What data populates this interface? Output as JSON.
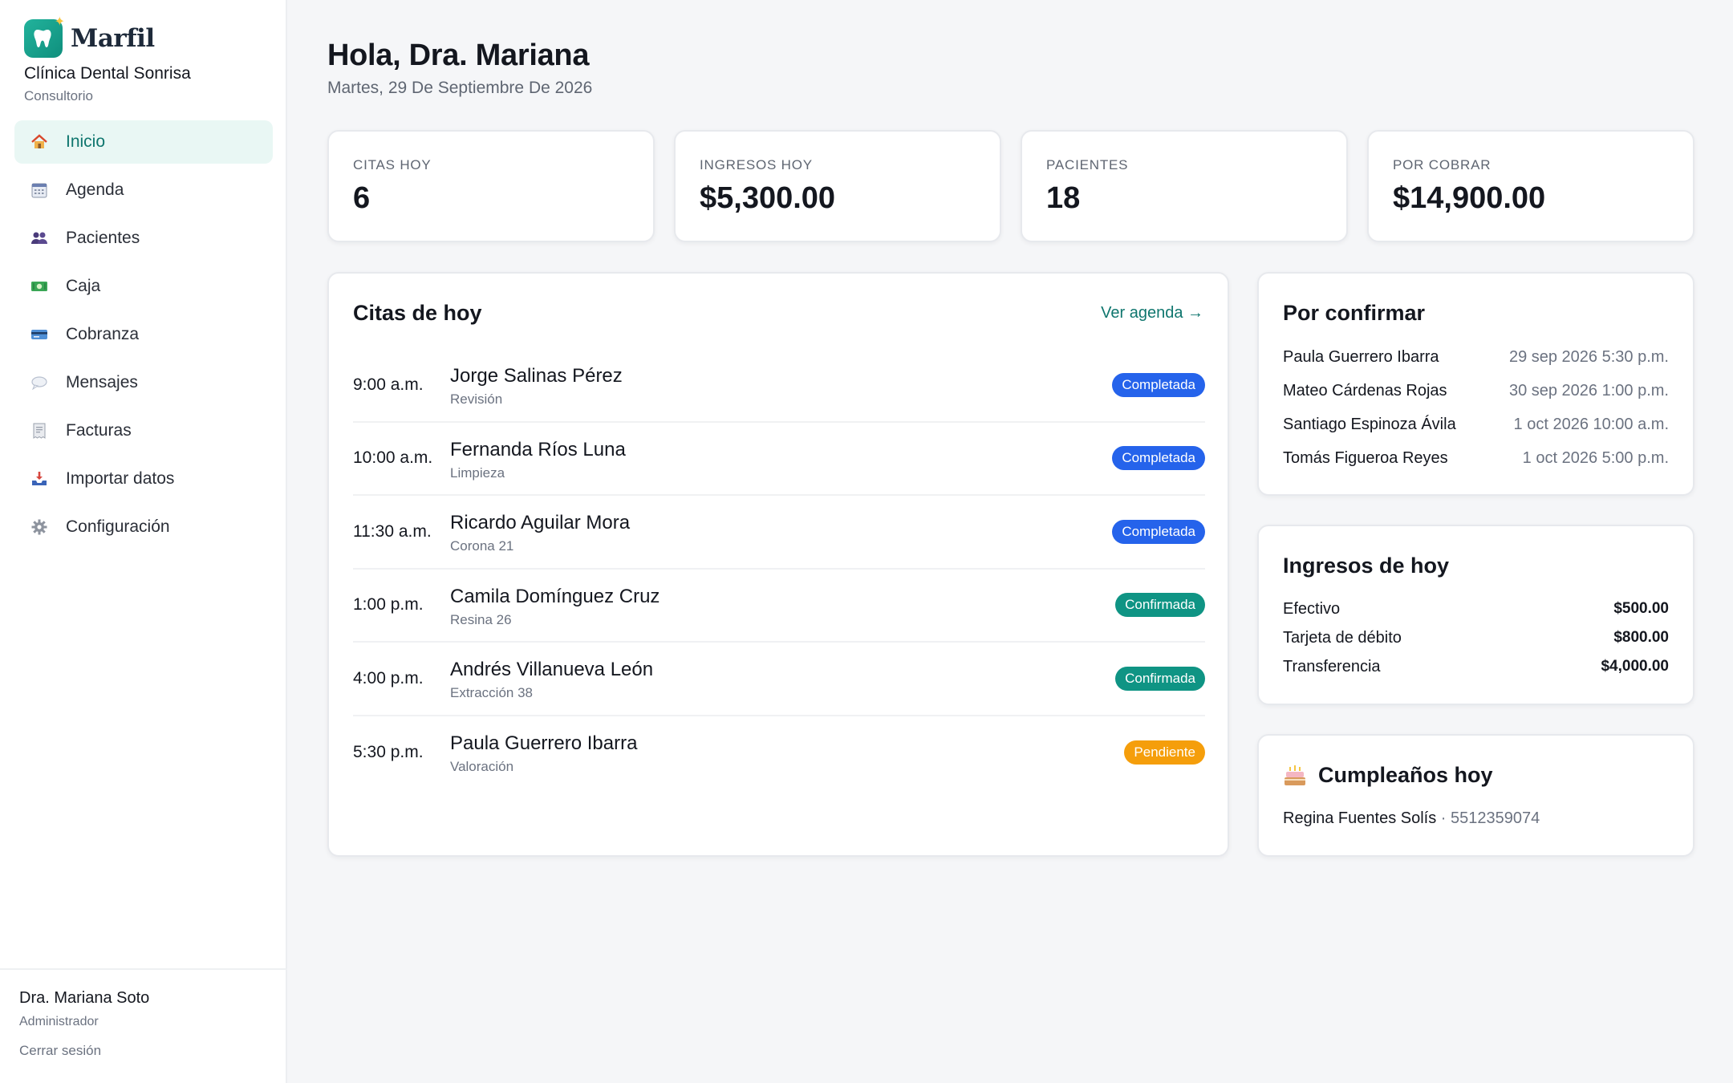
{
  "brand": {
    "name": "Marfil",
    "clinic": "Clínica Dental Sonrisa",
    "clinic_type": "Consultorio",
    "accent": "#0f766e"
  },
  "nav": [
    {
      "label": "Inicio",
      "icon": "house-icon",
      "active": true
    },
    {
      "label": "Agenda",
      "icon": "calendar-icon"
    },
    {
      "label": "Pacientes",
      "icon": "people-icon"
    },
    {
      "label": "Caja",
      "icon": "cash-icon"
    },
    {
      "label": "Cobranza",
      "icon": "credit-card-icon"
    },
    {
      "label": "Mensajes",
      "icon": "speech-bubble-icon"
    },
    {
      "label": "Facturas",
      "icon": "receipt-icon"
    },
    {
      "label": "Importar datos",
      "icon": "inbox-tray-icon"
    },
    {
      "label": "Configuración",
      "icon": "gear-icon"
    }
  ],
  "user": {
    "name": "Dra. Mariana Soto",
    "role": "Administrador",
    "logout": "Cerrar sesión"
  },
  "header": {
    "greeting": "Hola, Dra. Mariana",
    "date": "Martes, 29 De Septiembre De 2026"
  },
  "stats": [
    {
      "label": "CITAS HOY",
      "value": "6"
    },
    {
      "label": "INGRESOS HOY",
      "value": "$5,300.00"
    },
    {
      "label": "PACIENTES",
      "value": "18"
    },
    {
      "label": "POR COBRAR",
      "value": "$14,900.00"
    }
  ],
  "appointments": {
    "title": "Citas de hoy",
    "link": "Ver agenda →",
    "items": [
      {
        "time": "9:00 a.m.",
        "name": "Jorge Salinas Pérez",
        "detail": "Revisión",
        "status": "Completada",
        "status_color": "#2563eb"
      },
      {
        "time": "10:00 a.m.",
        "name": "Fernanda Ríos Luna",
        "detail": "Limpieza",
        "status": "Completada",
        "status_color": "#2563eb"
      },
      {
        "time": "11:30 a.m.",
        "name": "Ricardo Aguilar Mora",
        "detail": "Corona 21",
        "status": "Completada",
        "status_color": "#2563eb"
      },
      {
        "time": "1:00 p.m.",
        "name": "Camila Domínguez Cruz",
        "detail": "Resina 26",
        "status": "Confirmada",
        "status_color": "#0f9484"
      },
      {
        "time": "4:00 p.m.",
        "name": "Andrés Villanueva León",
        "detail": "Extracción 38",
        "status": "Confirmada",
        "status_color": "#0f9484"
      },
      {
        "time": "5:30 p.m.",
        "name": "Paula Guerrero Ibarra",
        "detail": "Valoración",
        "status": "Pendiente",
        "status_color": "#f59e0b"
      }
    ]
  },
  "to_confirm": {
    "title": "Por confirmar",
    "items": [
      {
        "name": "Paula Guerrero Ibarra",
        "when": "29 sep 2026 5:30 p.m."
      },
      {
        "name": "Mateo Cárdenas Rojas",
        "when": "30 sep 2026 1:00 p.m."
      },
      {
        "name": "Santiago Espinoza Ávila",
        "when": "1 oct 2026 10:00 a.m."
      },
      {
        "name": "Tomás Figueroa Reyes",
        "when": "1 oct 2026 5:00 p.m."
      }
    ]
  },
  "income": {
    "title": "Ingresos de hoy",
    "items": [
      {
        "method": "Efectivo",
        "amount": "$500.00"
      },
      {
        "method": "Tarjeta de débito",
        "amount": "$800.00"
      },
      {
        "method": "Transferencia",
        "amount": "$4,000.00"
      }
    ]
  },
  "birthdays": {
    "title": "Cumpleaños hoy",
    "icon": "cake-icon",
    "name": "Regina Fuentes Solís",
    "separator": " · ",
    "phone": "5512359074"
  }
}
